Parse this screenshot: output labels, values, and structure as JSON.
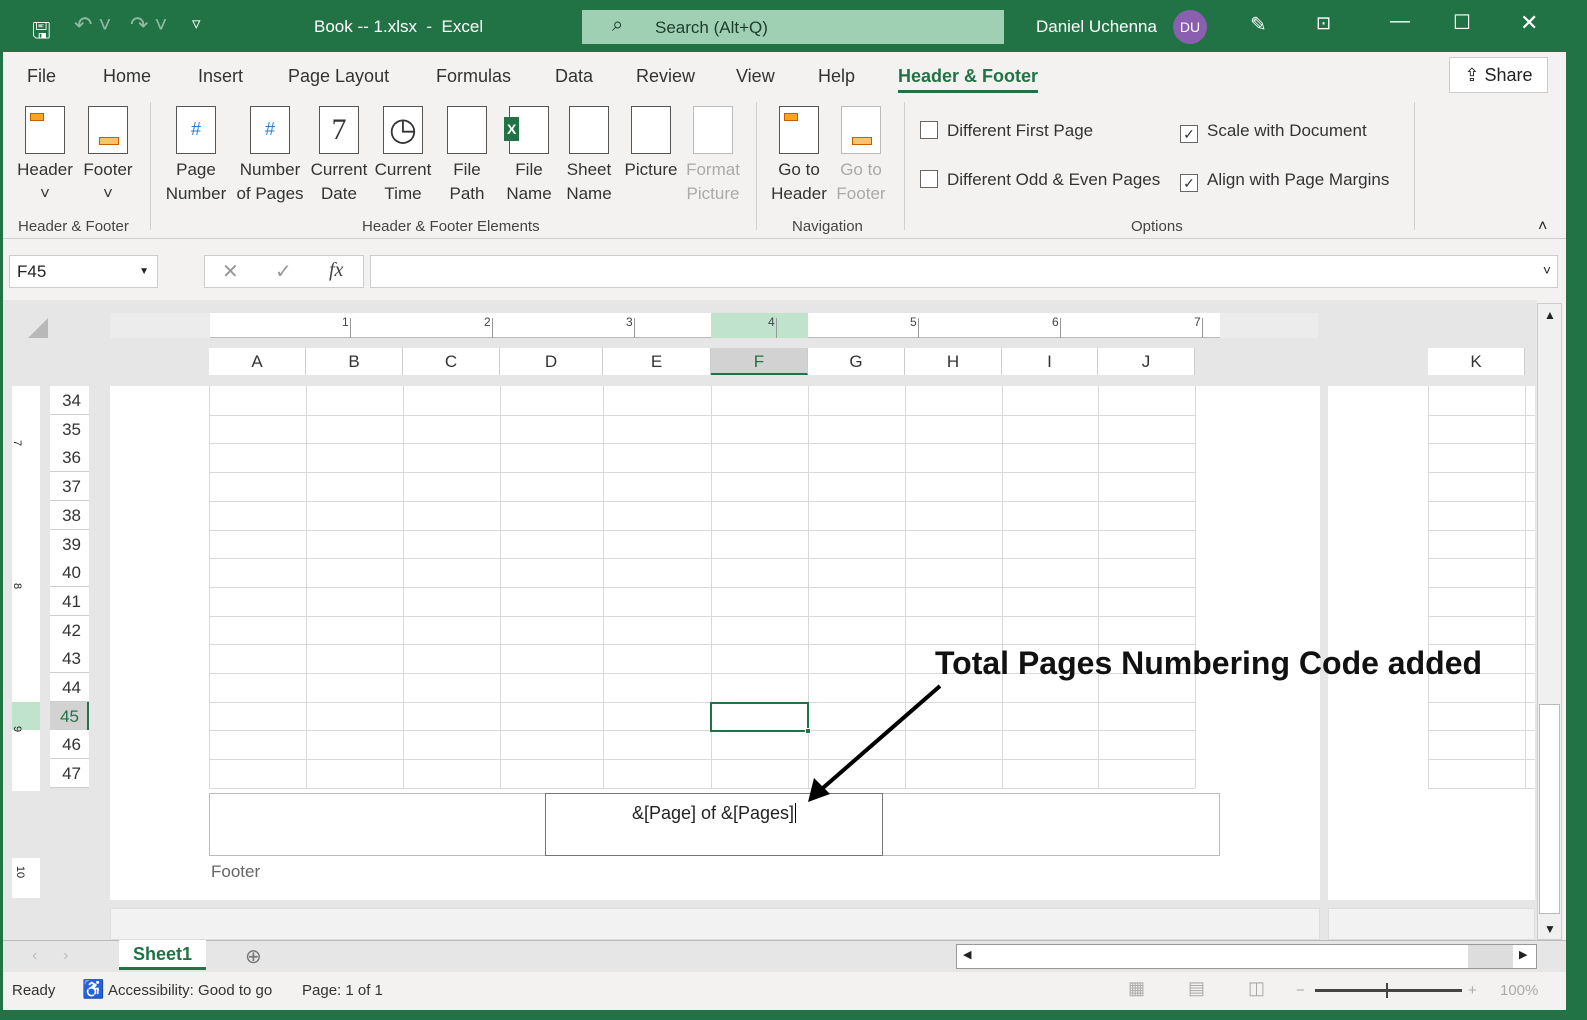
{
  "titlebar": {
    "title": "Book -- 1.xlsx  -  Excel",
    "search_placeholder": "Search (Alt+Q)",
    "user": "Daniel Uchenna",
    "initials": "DU"
  },
  "tabs": [
    "File",
    "Home",
    "Insert",
    "Page Layout",
    "Formulas",
    "Data",
    "Review",
    "View",
    "Help",
    "Header & Footer"
  ],
  "active_tab": "Header & Footer",
  "share": "Share",
  "ribbon": {
    "hf": [
      {
        "l1": "Header",
        "l2": "˅"
      },
      {
        "l1": "Footer",
        "l2": "˅"
      }
    ],
    "hf_group": "Header & Footer",
    "elements": [
      {
        "l1": "Page",
        "l2": "Number"
      },
      {
        "l1": "Number",
        "l2": "of Pages"
      },
      {
        "l1": "Current",
        "l2": "Date"
      },
      {
        "l1": "Current",
        "l2": "Time"
      },
      {
        "l1": "File",
        "l2": "Path"
      },
      {
        "l1": "File",
        "l2": "Name"
      },
      {
        "l1": "Sheet",
        "l2": "Name"
      },
      {
        "l1": "Picture",
        "l2": ""
      },
      {
        "l1": "Format",
        "l2": "Picture"
      }
    ],
    "elements_group": "Header & Footer Elements",
    "nav": [
      {
        "l1": "Go to",
        "l2": "Header"
      },
      {
        "l1": "Go to",
        "l2": "Footer"
      }
    ],
    "nav_group": "Navigation",
    "options": [
      {
        "label": "Different First Page",
        "checked": false
      },
      {
        "label": "Different Odd & Even Pages",
        "checked": false
      },
      {
        "label": "Scale with Document",
        "checked": true
      },
      {
        "label": "Align with Page Margins",
        "checked": true
      }
    ],
    "options_group": "Options"
  },
  "formula": {
    "namebox": "F45",
    "fx": "fx",
    "value": ""
  },
  "ruler": [
    "1",
    "2",
    "3",
    "4",
    "5",
    "6",
    "7"
  ],
  "columns": [
    "A",
    "B",
    "C",
    "D",
    "E",
    "F",
    "G",
    "H",
    "I",
    "J"
  ],
  "extra_column": "K",
  "rows": [
    "34",
    "35",
    "36",
    "37",
    "38",
    "39",
    "40",
    "41",
    "42",
    "43",
    "44",
    "45",
    "46",
    "47"
  ],
  "vruler": [
    "7",
    "8",
    "9",
    "10"
  ],
  "active_cell": "F45",
  "footer": {
    "center": "&[Page] of &[Pages]",
    "label": "Footer"
  },
  "annotation": "Total Pages Numbering Code added",
  "sheet_tab": "Sheet1",
  "status": {
    "ready": "Ready",
    "accessibility": "Accessibility: Good to go",
    "page": "Page: 1 of 1",
    "zoom": "100%"
  },
  "colors": {
    "accent": "#217346"
  }
}
